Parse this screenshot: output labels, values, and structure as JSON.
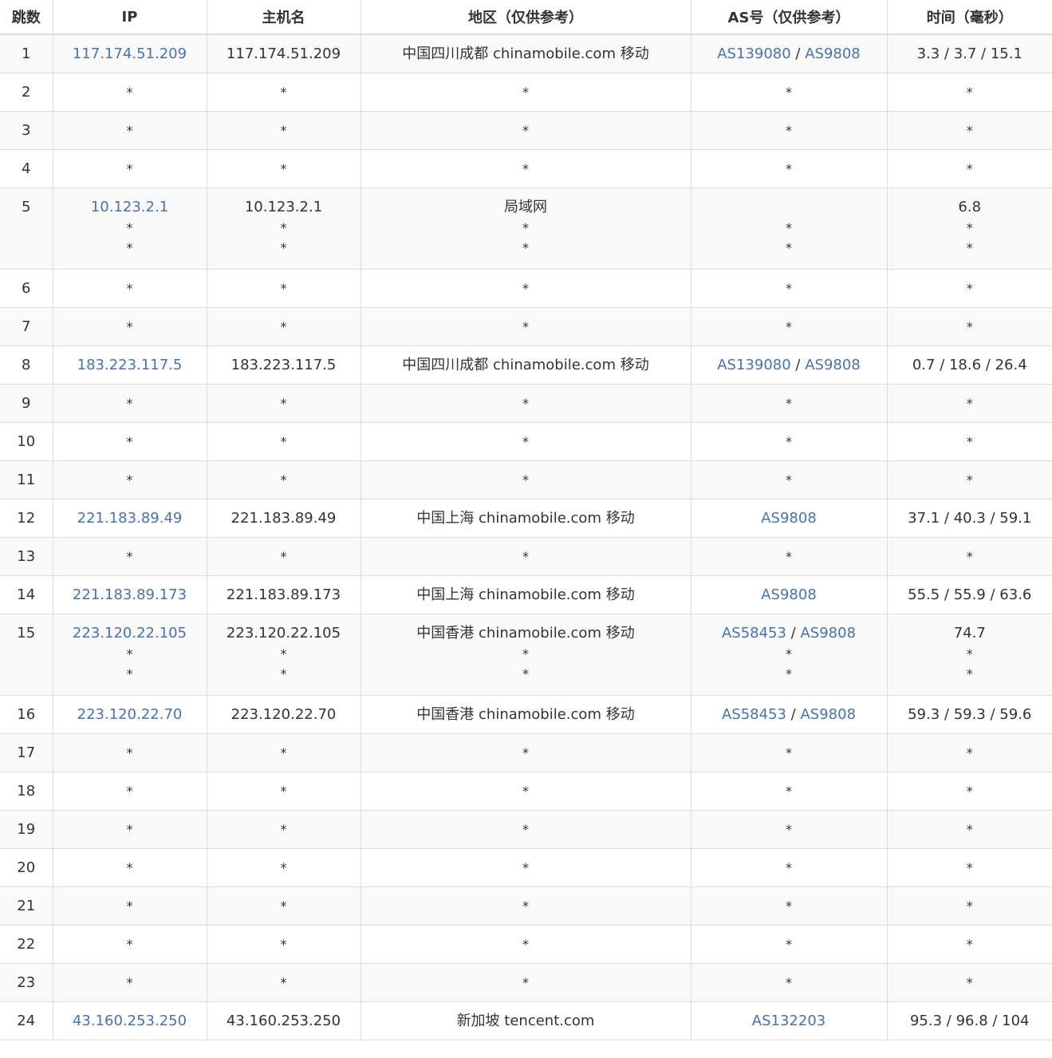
{
  "headers": [
    "跳数",
    "IP",
    "主机名",
    "地区（仅供参考）",
    "AS号（仅供参考）",
    "时间（毫秒）"
  ],
  "link_color": "#4a72a8",
  "rows": [
    {
      "hop": "1",
      "ip": [
        "117.174.51.209"
      ],
      "host": [
        "117.174.51.209"
      ],
      "region": [
        "中国四川成都 chinamobile.com 移动"
      ],
      "as": [
        [
          "AS139080",
          "AS9808"
        ]
      ],
      "time": [
        "3.3 / 3.7 / 15.1"
      ]
    },
    {
      "hop": "2",
      "ip": [
        "*"
      ],
      "host": [
        "*"
      ],
      "region": [
        "*"
      ],
      "as": [
        [
          "*"
        ]
      ],
      "time": [
        "*"
      ]
    },
    {
      "hop": "3",
      "ip": [
        "*"
      ],
      "host": [
        "*"
      ],
      "region": [
        "*"
      ],
      "as": [
        [
          "*"
        ]
      ],
      "time": [
        "*"
      ]
    },
    {
      "hop": "4",
      "ip": [
        "*"
      ],
      "host": [
        "*"
      ],
      "region": [
        "*"
      ],
      "as": [
        [
          "*"
        ]
      ],
      "time": [
        "*"
      ]
    },
    {
      "hop": "5",
      "ip": [
        "10.123.2.1",
        "*",
        "*"
      ],
      "host": [
        "10.123.2.1",
        "*",
        "*"
      ],
      "region": [
        "局域网",
        "*",
        "*"
      ],
      "as": [
        [],
        [
          "*"
        ],
        [
          "*"
        ]
      ],
      "time": [
        "6.8",
        "*",
        "*"
      ]
    },
    {
      "hop": "6",
      "ip": [
        "*"
      ],
      "host": [
        "*"
      ],
      "region": [
        "*"
      ],
      "as": [
        [
          "*"
        ]
      ],
      "time": [
        "*"
      ]
    },
    {
      "hop": "7",
      "ip": [
        "*"
      ],
      "host": [
        "*"
      ],
      "region": [
        "*"
      ],
      "as": [
        [
          "*"
        ]
      ],
      "time": [
        "*"
      ]
    },
    {
      "hop": "8",
      "ip": [
        "183.223.117.5"
      ],
      "host": [
        "183.223.117.5"
      ],
      "region": [
        "中国四川成都 chinamobile.com 移动"
      ],
      "as": [
        [
          "AS139080",
          "AS9808"
        ]
      ],
      "time": [
        "0.7 / 18.6 / 26.4"
      ]
    },
    {
      "hop": "9",
      "ip": [
        "*"
      ],
      "host": [
        "*"
      ],
      "region": [
        "*"
      ],
      "as": [
        [
          "*"
        ]
      ],
      "time": [
        "*"
      ]
    },
    {
      "hop": "10",
      "ip": [
        "*"
      ],
      "host": [
        "*"
      ],
      "region": [
        "*"
      ],
      "as": [
        [
          "*"
        ]
      ],
      "time": [
        "*"
      ]
    },
    {
      "hop": "11",
      "ip": [
        "*"
      ],
      "host": [
        "*"
      ],
      "region": [
        "*"
      ],
      "as": [
        [
          "*"
        ]
      ],
      "time": [
        "*"
      ]
    },
    {
      "hop": "12",
      "ip": [
        "221.183.89.49"
      ],
      "host": [
        "221.183.89.49"
      ],
      "region": [
        "中国上海 chinamobile.com 移动"
      ],
      "as": [
        [
          "AS9808"
        ]
      ],
      "time": [
        "37.1 / 40.3 / 59.1"
      ]
    },
    {
      "hop": "13",
      "ip": [
        "*"
      ],
      "host": [
        "*"
      ],
      "region": [
        "*"
      ],
      "as": [
        [
          "*"
        ]
      ],
      "time": [
        "*"
      ]
    },
    {
      "hop": "14",
      "ip": [
        "221.183.89.173"
      ],
      "host": [
        "221.183.89.173"
      ],
      "region": [
        "中国上海 chinamobile.com 移动"
      ],
      "as": [
        [
          "AS9808"
        ]
      ],
      "time": [
        "55.5 / 55.9 / 63.6"
      ]
    },
    {
      "hop": "15",
      "ip": [
        "223.120.22.105",
        "*",
        "*"
      ],
      "host": [
        "223.120.22.105",
        "*",
        "*"
      ],
      "region": [
        "中国香港 chinamobile.com 移动",
        "*",
        "*"
      ],
      "as": [
        [
          "AS58453",
          "AS9808"
        ],
        [
          "*"
        ],
        [
          "*"
        ]
      ],
      "time": [
        "74.7",
        "*",
        "*"
      ]
    },
    {
      "hop": "16",
      "ip": [
        "223.120.22.70"
      ],
      "host": [
        "223.120.22.70"
      ],
      "region": [
        "中国香港 chinamobile.com 移动"
      ],
      "as": [
        [
          "AS58453",
          "AS9808"
        ]
      ],
      "time": [
        "59.3 / 59.3 / 59.6"
      ]
    },
    {
      "hop": "17",
      "ip": [
        "*"
      ],
      "host": [
        "*"
      ],
      "region": [
        "*"
      ],
      "as": [
        [
          "*"
        ]
      ],
      "time": [
        "*"
      ]
    },
    {
      "hop": "18",
      "ip": [
        "*"
      ],
      "host": [
        "*"
      ],
      "region": [
        "*"
      ],
      "as": [
        [
          "*"
        ]
      ],
      "time": [
        "*"
      ]
    },
    {
      "hop": "19",
      "ip": [
        "*"
      ],
      "host": [
        "*"
      ],
      "region": [
        "*"
      ],
      "as": [
        [
          "*"
        ]
      ],
      "time": [
        "*"
      ]
    },
    {
      "hop": "20",
      "ip": [
        "*"
      ],
      "host": [
        "*"
      ],
      "region": [
        "*"
      ],
      "as": [
        [
          "*"
        ]
      ],
      "time": [
        "*"
      ]
    },
    {
      "hop": "21",
      "ip": [
        "*"
      ],
      "host": [
        "*"
      ],
      "region": [
        "*"
      ],
      "as": [
        [
          "*"
        ]
      ],
      "time": [
        "*"
      ]
    },
    {
      "hop": "22",
      "ip": [
        "*"
      ],
      "host": [
        "*"
      ],
      "region": [
        "*"
      ],
      "as": [
        [
          "*"
        ]
      ],
      "time": [
        "*"
      ]
    },
    {
      "hop": "23",
      "ip": [
        "*"
      ],
      "host": [
        "*"
      ],
      "region": [
        "*"
      ],
      "as": [
        [
          "*"
        ]
      ],
      "time": [
        "*"
      ]
    },
    {
      "hop": "24",
      "ip": [
        "43.160.253.250"
      ],
      "host": [
        "43.160.253.250"
      ],
      "region": [
        "新加坡 tencent.com"
      ],
      "as": [
        [
          "AS132203"
        ]
      ],
      "time": [
        "95.3 / 96.8 / 104"
      ]
    }
  ]
}
